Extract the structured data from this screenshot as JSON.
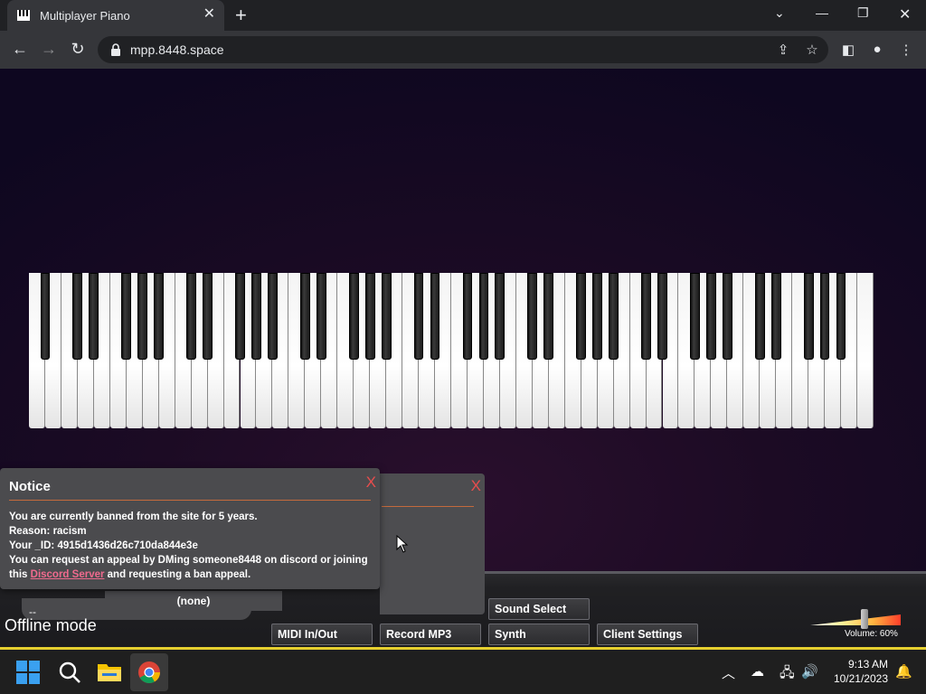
{
  "browser": {
    "tab_title": "Multiplayer Piano",
    "url": "mpp.8448.space"
  },
  "notice": {
    "title": "Notice",
    "close_label": "X",
    "line1": "You are currently banned from the site for 5 years.",
    "line2": "Reason: racism",
    "line3": "Your _ID: 4915d1436d26c710da844e3e",
    "line4": "You can request an appeal by DMing someone8448 on discord or joining",
    "line5_prefix": "this ",
    "line5_link": "Discord Server",
    "line5_suffix": " and requesting a ban appeal."
  },
  "second_dialog": {
    "close_label": "X"
  },
  "room": {
    "selected": "--",
    "tag": "(none)"
  },
  "controls": {
    "sound_select": "Sound Select",
    "midi": "MIDI In/Out",
    "record": "Record MP3",
    "synth": "Synth",
    "client_settings": "Client Settings"
  },
  "status": {
    "offline": "Offline mode"
  },
  "volume": {
    "label": "Volume: 60%",
    "value": 0.6
  },
  "taskbar": {
    "time": "9:13 AM",
    "date": "10/21/2023"
  },
  "piano": {
    "white_keys": 52
  }
}
